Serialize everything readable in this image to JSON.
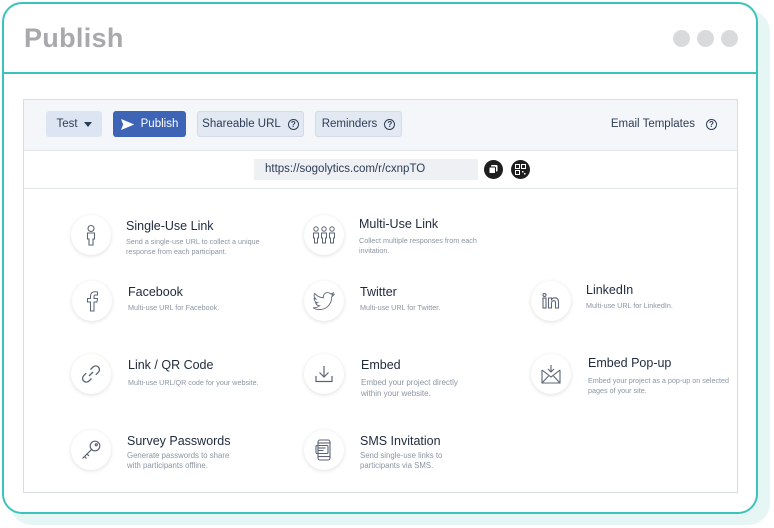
{
  "window": {
    "title": "Publish"
  },
  "toolbar": {
    "test_label": "Test",
    "publish_label": "Publish",
    "shareable_label": "Shareable URL",
    "reminders_label": "Reminders",
    "email_templates_label": "Email Templates",
    "help_glyph": "?"
  },
  "url": {
    "value": "https://sogolytics.com/r/cxnpTO"
  },
  "options": {
    "single_use": {
      "title": "Single-Use Link",
      "desc": "Send a single-use URL to collect a unique response from each participant.",
      "icon": "person-icon"
    },
    "multi_use": {
      "title": "Multi-Use Link",
      "desc": "Collect multiple responses from each invitation.",
      "icon": "group-icon"
    },
    "facebook": {
      "title": "Facebook",
      "desc": "Multi-use URL for Facebook.",
      "icon": "facebook-icon"
    },
    "twitter": {
      "title": "Twitter",
      "desc": "Multi-use URL for Twitter.",
      "icon": "twitter-icon"
    },
    "linkedin": {
      "title": "LinkedIn",
      "desc": "Multi-use URL for LinkedIn.",
      "icon": "linkedin-icon"
    },
    "link_qr": {
      "title": "Link / QR Code",
      "desc": "Multi-use URL/QR code for your website.",
      "icon": "link-icon"
    },
    "embed": {
      "title": "Embed",
      "desc": "Embed your project directly within your website.",
      "icon": "download-icon"
    },
    "embed_popup": {
      "title": "Embed Pop-up",
      "desc": "Embed your project as a pop-up on selected pages of your site.",
      "icon": "mail-icon"
    },
    "survey_passwords": {
      "title": "Survey Passwords",
      "desc": "Generate passwords to share with participants offline.",
      "icon": "key-icon"
    },
    "sms": {
      "title": "SMS Invitation",
      "desc": "Send single-use links to participants via SMS.",
      "icon": "sms-icon"
    }
  },
  "colors": {
    "accent": "#3cc3b9",
    "primary_button": "#3e64b5",
    "text_dark": "#1f2a3d",
    "text_muted": "#8c95a3"
  }
}
